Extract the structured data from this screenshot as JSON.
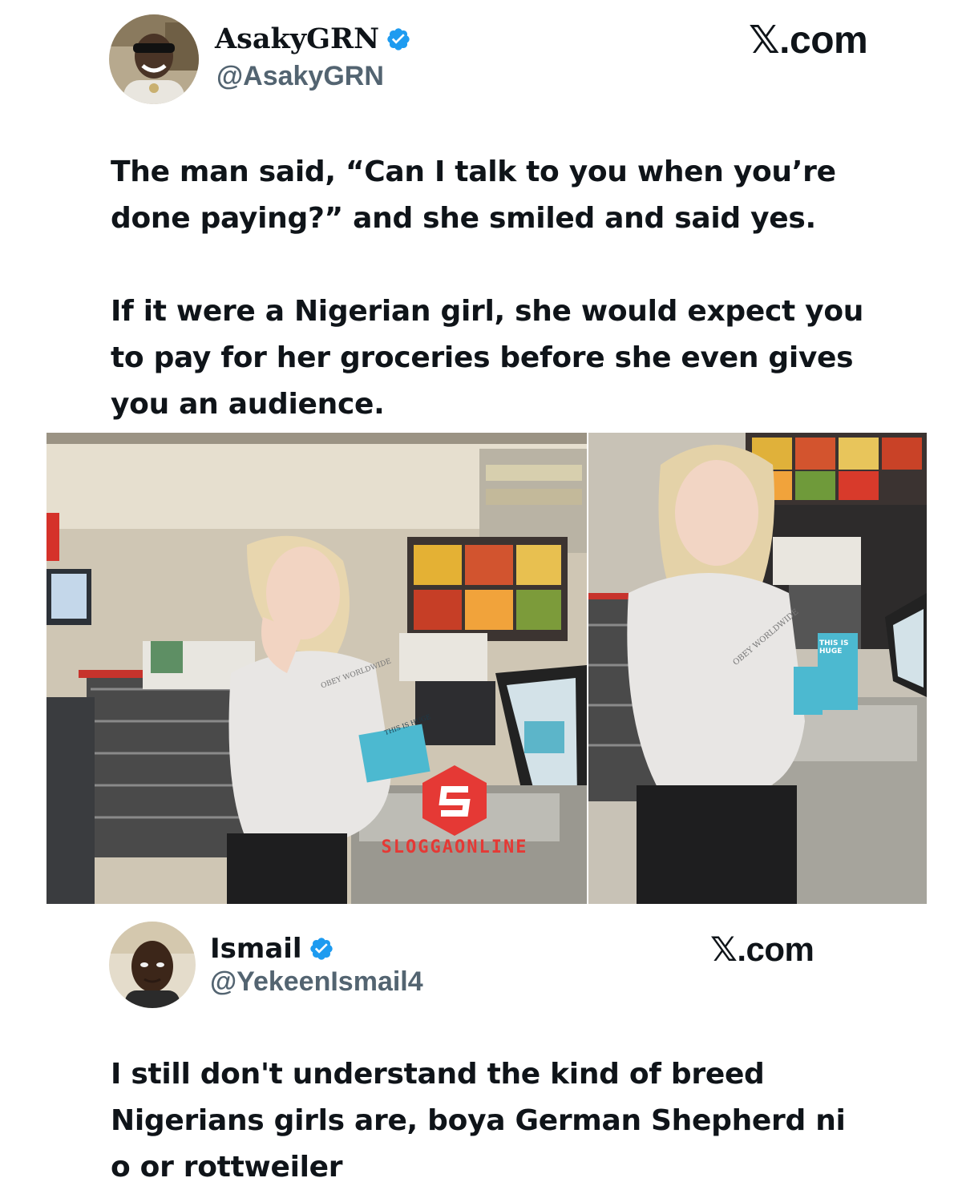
{
  "tweet": {
    "display_name": "AsakyGRN",
    "handle": "@AsakyGRN",
    "brand": "𝕏.com",
    "verified": true,
    "text_p1": "The man said, “Can I talk to you when you’re done paying?” and she smiled and said yes.",
    "text_p2": "If it were a Nigerian girl, she would expect you to pay for her groceries before she even gives you an audience."
  },
  "photos": {
    "left_shirt_text": "OBEY WORLDWIDE",
    "left_box_text": "THIS IS HUGE",
    "right_shirt_text": "OBEY WORLDWIDE",
    "right_box_text": "THIS IS HUGE",
    "watermark": "SLOGGAONLINE"
  },
  "reply": {
    "display_name": "Ismail",
    "handle": "@YekeenIsmail4",
    "brand": "𝕏.com",
    "verified": true,
    "text": "I still don't understand the kind of breed Nigerians girls are, boya German Shepherd ni o or rottweiler"
  },
  "colors": {
    "verified_blue": "#1d9bf0",
    "text": "#0f1419",
    "watermark_red": "#e53935"
  }
}
